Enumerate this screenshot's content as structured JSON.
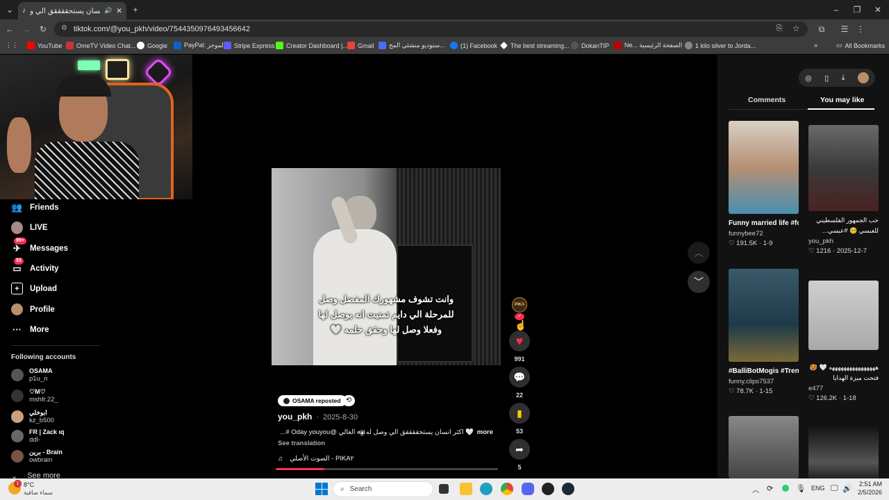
{
  "browser": {
    "tab_title": "اكثر انسان يستحققققق الي و",
    "url": "tiktok.com/@you_pkh/video/7544350976493456642",
    "bookmarks": [
      "YouTube",
      "OmeTV Video Chat...",
      "Google",
      "PayPal: الموجز",
      "Stripe Express",
      "Creator Dashboard |...",
      "Gmail",
      "ستوديو منشئي المح...",
      "(1) Facebook",
      "The best streaming...",
      "DokanTIP",
      "Ne... الصفحة الرئيسية",
      "1 kilo silver to Jorda..."
    ],
    "all_bookmarks": "All Bookmarks"
  },
  "sidebar": {
    "nav": [
      {
        "label": "Friends",
        "icon": "friends-icon",
        "badge": ""
      },
      {
        "label": "LIVE",
        "icon": "live-icon",
        "badge": ""
      },
      {
        "label": "Messages",
        "icon": "messages-icon",
        "badge": "99+"
      },
      {
        "label": "Activity",
        "icon": "activity-icon",
        "badge": "53"
      },
      {
        "label": "Upload",
        "icon": "upload-icon",
        "badge": ""
      },
      {
        "label": "Profile",
        "icon": "profile-icon",
        "badge": ""
      },
      {
        "label": "More",
        "icon": "more-icon",
        "badge": ""
      }
    ],
    "following_title": "Following accounts",
    "accounts": [
      {
        "name": "OSAMA",
        "handle": "p1u_n"
      },
      {
        "name": "♡M♡",
        "handle": "mshfr.22_"
      },
      {
        "name": "ابوخلي",
        "handle": "kz_b500"
      },
      {
        "name": "FR | Zack ıq",
        "handle": "ddl-"
      },
      {
        "name": "برين - Brain",
        "handle": "owbrain"
      }
    ],
    "see_more": "See more"
  },
  "video": {
    "caption_lines": [
      "وانت تشوف مشهورك المفضل وصل",
      "للمرحلة الي دايم تمنيت انه يوصل لها",
      "وفعلا وصل لها وحقق حلمه 🤍"
    ],
    "creator_badge": "PIKA",
    "reposted_label": "OSAMA reposted",
    "author": "you_pkh",
    "date": "2025-8-30",
    "description": "🤍 اكثر انسان يستحققققق الي وصل له وﷲ الغالي @Oday youyou #...",
    "more": "more",
    "see_translation": "See translation",
    "sound": "الصوت الأصلي - PIKA٢",
    "progress": 0.22
  },
  "actions": {
    "likes": "991",
    "comments": "22",
    "saves": "53",
    "shares": "5"
  },
  "right_panel": {
    "tabs": [
      "Comments",
      "You may like"
    ],
    "active_tab": "You may like",
    "cards": [
      {
        "title": "Funny married life #foryou #couple...",
        "author": "funnybee72",
        "stats": "♡ 191.5K · 1-9"
      },
      {
        "title": "حب الجمهور الفلسطيني للعبسي 🥺 #عبسي...",
        "author": "you_pkh",
        "stats": "♡ 1216 · 2025-12-7"
      },
      {
        "title": "#BalliBotMogis #TrendingReels...",
        "author": "funny.clips7537",
        "stats": "♡ 78.7K · 1-15"
      },
      {
        "title": "ههههههههههههههههه 🤍 🥵 فتحت ميزة الهدايا",
        "author": "e477",
        "stats": "♡ 126.2K · 1-18"
      }
    ]
  },
  "taskbar": {
    "weather_temp": "8°C",
    "weather_desc": "سماء صافية",
    "weather_badge": "1",
    "search": "Search",
    "lang": "ENG",
    "time": "2:51 AM",
    "date": "2/5/2026"
  },
  "colors": {
    "accent": "#fe2c55",
    "save": "#facd00"
  }
}
